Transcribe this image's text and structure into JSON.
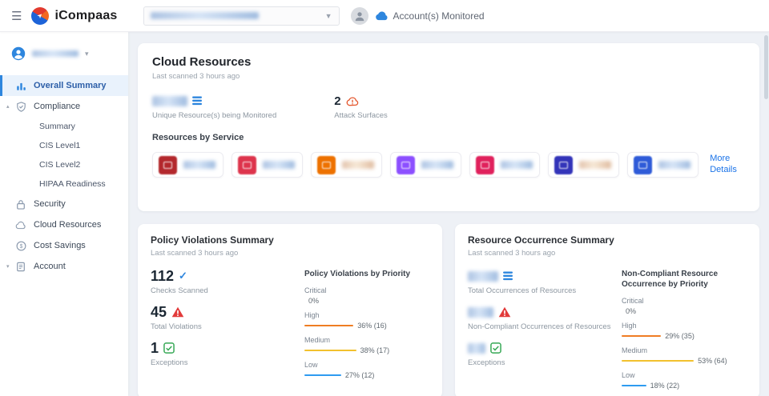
{
  "header": {
    "brand": "iCompaas",
    "accounts_monitored": "Account(s) Monitored"
  },
  "sidebar": {
    "overall_summary": "Overall Summary",
    "compliance": "Compliance",
    "compliance_children": {
      "summary": "Summary",
      "cis1": "CIS Level1",
      "cis2": "CIS Level2",
      "hipaa": "HIPAA Readiness"
    },
    "security": "Security",
    "cloud_resources": "Cloud Resources",
    "cost_savings": "Cost Savings",
    "account": "Account"
  },
  "cloud": {
    "title": "Cloud Resources",
    "scanned": "Last scanned 3 hours ago",
    "unique_label": "Unique Resource(s) being Monitored",
    "attack_value": "2",
    "attack_label": "Attack Surfaces",
    "by_service": "Resources by Service",
    "more_details": "More Details"
  },
  "policy": {
    "title": "Policy Violations Summary",
    "scanned": "Last scanned 3 hours ago",
    "checks_value": "112",
    "checks_label": "Checks Scanned",
    "violations_value": "45",
    "violations_label": "Total Violations",
    "exceptions_value": "1",
    "exceptions_label": "Exceptions",
    "chart": {
      "type": "bar",
      "title": "Policy Violations by Priority",
      "rows": [
        {
          "label": "Critical",
          "text": "0%",
          "pct": 0,
          "color": "#e23b3b"
        },
        {
          "label": "High",
          "text": "36% (16)",
          "pct": 36,
          "color": "#ef7d23"
        },
        {
          "label": "Medium",
          "text": "38% (17)",
          "pct": 38,
          "color": "#f2c12e"
        },
        {
          "label": "Low",
          "text": "27% (12)",
          "pct": 27,
          "color": "#2e9bf0"
        }
      ]
    }
  },
  "occurrence": {
    "title": "Resource Occurrence Summary",
    "scanned": "Last scanned 3 hours ago",
    "total_label": "Total Occurrences of Resources",
    "noncompliant_label": "Non-Compliant Occurrences of Resources",
    "exceptions_label": "Exceptions",
    "chart": {
      "type": "bar",
      "title": "Non-Compliant Resource Occurrence by Priority",
      "rows": [
        {
          "label": "Critical",
          "text": "0%",
          "pct": 0,
          "color": "#e23b3b"
        },
        {
          "label": "High",
          "text": "29% (35)",
          "pct": 29,
          "color": "#ef7d23"
        },
        {
          "label": "Medium",
          "text": "53% (64)",
          "pct": 53,
          "color": "#f2c12e"
        },
        {
          "label": "Low",
          "text": "18% (22)",
          "pct": 18,
          "color": "#2e9bf0"
        }
      ]
    }
  },
  "tiles": {
    "colors": [
      "#b3282d",
      "#dd344c",
      "#ed7100",
      "#8c4fff",
      "#e0215c",
      "#3334b9",
      "#2f5bd8"
    ]
  }
}
